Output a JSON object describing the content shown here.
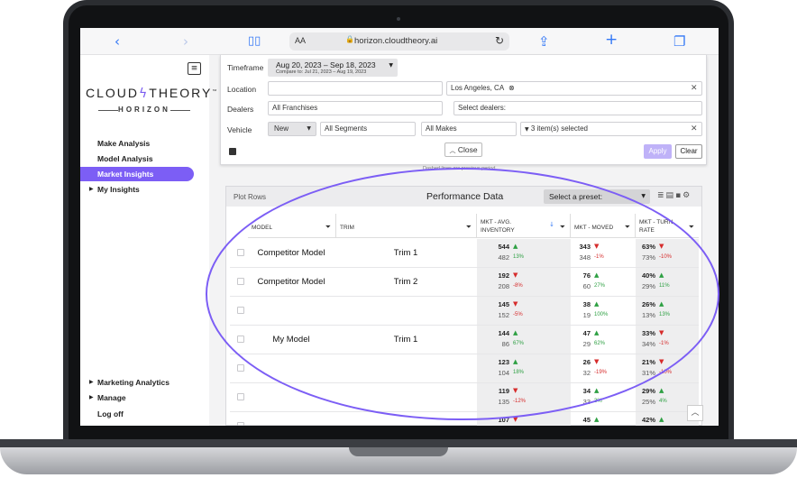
{
  "browser": {
    "url": "horizon.cloudtheory.ai",
    "aa_label": "AA"
  },
  "sidebar": {
    "brand_left": "CLOUD",
    "brand_right": "THEORY",
    "tm": "™",
    "brand_sub": "HORIZON",
    "items": [
      {
        "label": "Make Analysis"
      },
      {
        "label": "Model Analysis"
      },
      {
        "label": "Market Insights",
        "active": true
      },
      {
        "label": "My Insights",
        "caret": "▶"
      }
    ],
    "bottom_items": [
      {
        "label": "Marketing Analytics",
        "caret": "▶"
      },
      {
        "label": "Manage",
        "caret": "▶"
      },
      {
        "label": "Log off"
      }
    ]
  },
  "filters": {
    "timeframe_label": "Timeframe",
    "timeframe_value": "Aug 20, 2023 – Sep 18, 2023",
    "timeframe_compare": "Compare to: Jul 21, 2023 – Aug 19, 2023",
    "location_label": "Location",
    "location_chip": "Los Angeles, CA",
    "dealers_label": "Dealers",
    "dealers_franchise": "All Franchises",
    "dealers_select_placeholder": "Select dealers:",
    "vehicle_label": "Vehicle",
    "vehicle_condition": "New",
    "vehicle_segments": "All Segments",
    "vehicle_makes": "All Makes",
    "vehicle_selected": "3 item(s) selected",
    "close_label": "Close",
    "apply_label": "Apply",
    "clear_label": "Clear",
    "note": "Dashed lines are previous period."
  },
  "performance": {
    "plot_rows_label": "Plot Rows",
    "title": "Performance Data",
    "preset_placeholder": "Select a preset:",
    "columns": {
      "model": "MODEL",
      "trim": "TRIM",
      "inventory": [
        "MKT - AVG.",
        "INVENTORY"
      ],
      "moved": "MKT - MOVED",
      "turn": [
        "MKT - TURN",
        "RATE"
      ]
    },
    "rows": [
      {
        "model": "Competitor Model",
        "trim": "Trim 1",
        "inv": {
          "cur": "544",
          "prev": "482",
          "dir": "up",
          "pct": "13%"
        },
        "mov": {
          "cur": "343",
          "prev": "348",
          "dir": "down",
          "pct": "-1%"
        },
        "turn": {
          "cur": "63%",
          "prev": "73%",
          "dir": "down",
          "pct": "-10%"
        }
      },
      {
        "model": "Competitor Model",
        "trim": "Trim 2",
        "inv": {
          "cur": "192",
          "prev": "208",
          "dir": "down",
          "pct": "-8%"
        },
        "mov": {
          "cur": "76",
          "prev": "60",
          "dir": "up",
          "pct": "27%"
        },
        "turn": {
          "cur": "40%",
          "prev": "29%",
          "dir": "up",
          "pct": "11%"
        }
      },
      {
        "model": "",
        "trim": "",
        "inv": {
          "cur": "145",
          "prev": "152",
          "dir": "down",
          "pct": "-5%"
        },
        "mov": {
          "cur": "38",
          "prev": "19",
          "dir": "up",
          "pct": "100%"
        },
        "turn": {
          "cur": "26%",
          "prev": "13%",
          "dir": "up",
          "pct": "13%"
        }
      },
      {
        "model": "My Model",
        "trim": "Trim 1",
        "inv": {
          "cur": "144",
          "prev": "86",
          "dir": "up",
          "pct": "67%"
        },
        "mov": {
          "cur": "47",
          "prev": "29",
          "dir": "up",
          "pct": "62%"
        },
        "turn": {
          "cur": "33%",
          "prev": "34%",
          "dir": "down",
          "pct": "-1%"
        }
      },
      {
        "model": "",
        "trim": "",
        "inv": {
          "cur": "123",
          "prev": "104",
          "dir": "up",
          "pct": "18%"
        },
        "mov": {
          "cur": "26",
          "prev": "32",
          "dir": "down",
          "pct": "-19%"
        },
        "turn": {
          "cur": "21%",
          "prev": "31%",
          "dir": "down",
          "pct": "-10%"
        }
      },
      {
        "model": "",
        "trim": "",
        "inv": {
          "cur": "119",
          "prev": "135",
          "dir": "down",
          "pct": "-12%"
        },
        "mov": {
          "cur": "34",
          "prev": "33",
          "dir": "up",
          "pct": "3%"
        },
        "turn": {
          "cur": "29%",
          "prev": "25%",
          "dir": "up",
          "pct": "4%"
        }
      },
      {
        "model": "",
        "trim": "",
        "inv": {
          "cur": "107",
          "prev": "",
          "dir": "down",
          "pct": ""
        },
        "mov": {
          "cur": "45",
          "prev": "",
          "dir": "up",
          "pct": ""
        },
        "turn": {
          "cur": "42%",
          "prev": "",
          "dir": "up",
          "pct": ""
        }
      }
    ]
  },
  "colors": {
    "accent": "#7c5ef5",
    "up": "#2ea043",
    "down": "#d62c2c"
  }
}
